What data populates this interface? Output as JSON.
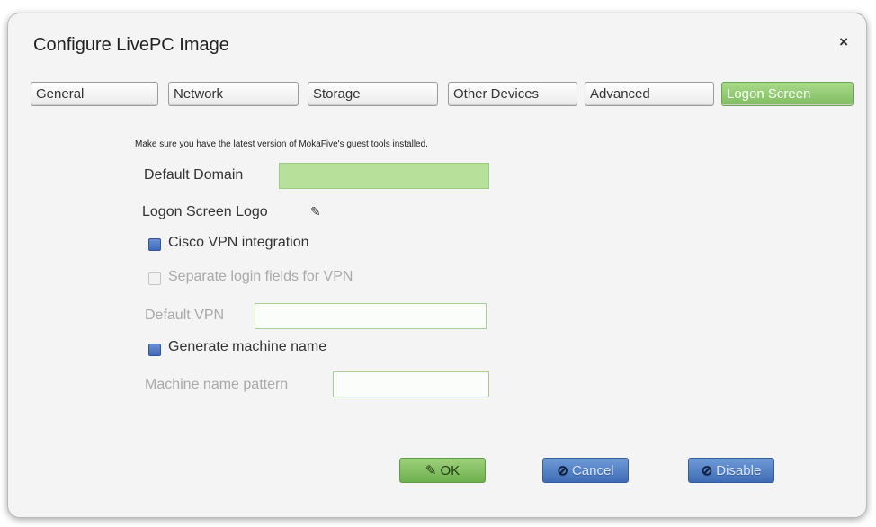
{
  "dialog": {
    "title": "Configure LivePC Image",
    "close": "×"
  },
  "tabs": [
    {
      "label": "General",
      "active": false
    },
    {
      "label": "Network",
      "active": false
    },
    {
      "label": "Storage",
      "active": false
    },
    {
      "label": "Other Devices",
      "active": false
    },
    {
      "label": "Advanced",
      "active": false
    },
    {
      "label": "Logon Screen",
      "active": true
    }
  ],
  "form": {
    "notice": "Make sure you have the latest version of MokaFive's guest tools installed.",
    "default_domain_label": "Default Domain",
    "default_domain_value": "",
    "logon_logo_label": "Logon Screen Logo",
    "logon_logo_icon": "pencil-icon",
    "cisco_vpn_label": "Cisco VPN integration",
    "cisco_vpn_checked": true,
    "separate_login_label": "Separate login fields for VPN",
    "separate_login_checked": false,
    "default_vpn_label": "Default VPN",
    "default_vpn_value": "",
    "generate_name_label": "Generate machine name",
    "generate_name_checked": true,
    "machine_pattern_label": "Machine name pattern",
    "machine_pattern_value": ""
  },
  "buttons": {
    "ok": {
      "label": "OK",
      "icon": "pencil-icon"
    },
    "cancel": {
      "label": "Cancel",
      "icon": "cancel-icon"
    },
    "disable": {
      "label": "Disable",
      "icon": "disable-icon"
    }
  },
  "colors": {
    "active_tab": "#8cc76c",
    "checked_box": "#4a74be",
    "ok_button": "#7fbd60",
    "blue_button": "#4f7cc4"
  }
}
